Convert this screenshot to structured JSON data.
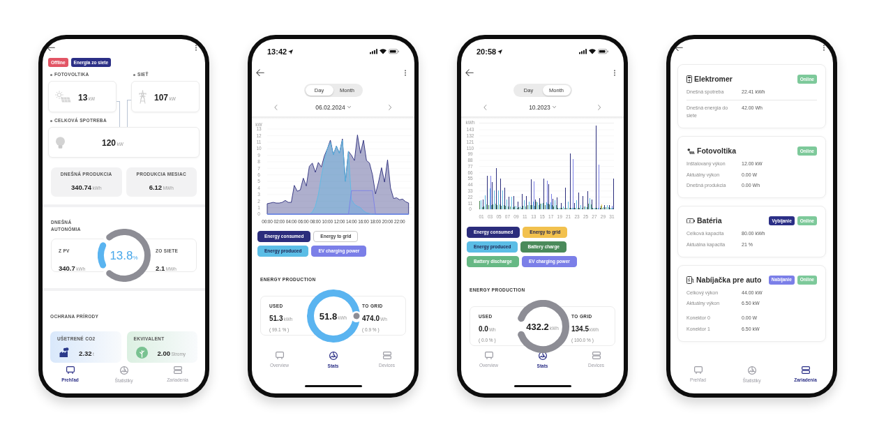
{
  "phones": [
    {
      "kind": "overview",
      "badges": [
        {
          "label": "Offline",
          "color": "#e25565"
        },
        {
          "label": "Energia zo siete",
          "color": "#2b2f86"
        }
      ],
      "flow": {
        "pv": {
          "label": "FOTOVOLTIKA",
          "value": "13",
          "unit": "kW"
        },
        "grid": {
          "label": "SIEŤ",
          "value": "107",
          "unit": "kW"
        },
        "consumption": {
          "label": "CELKOVÁ SPOTREBA",
          "value": "120",
          "unit": "kW"
        }
      },
      "tiles": [
        {
          "label": "DNEŠNÁ PRODUKCIA",
          "value": "340.74",
          "unit": "kWh"
        },
        {
          "label": "PRODUKCIA MESIAC",
          "value": "6.12",
          "unit": "MWh"
        }
      ],
      "autonomy": {
        "title": "DNEŠNÁ AUTONÓMIA",
        "value": "13.8",
        "unit": "%",
        "level": 0.138,
        "left": {
          "label": "Z PV",
          "value": "340.7",
          "unit": "kWh"
        },
        "right": {
          "label": "ZO SIETE",
          "value": "2.1",
          "unit": "MWh"
        }
      },
      "nature": {
        "title": "OCHRANA PRÍRODY",
        "cards": [
          {
            "label": "UŠETRENÉ CO2",
            "value": "2.32",
            "unit": "t",
            "color": "#d9e8fb"
          },
          {
            "label": "EKVIVALENT",
            "value": "2.00",
            "unit": "Stromy",
            "color": "#dcf0e2"
          }
        ]
      },
      "nav": [
        {
          "label": "Prehľad",
          "selected": true
        },
        {
          "label": "Štatistiky",
          "selected": false
        },
        {
          "label": "Zariadenia",
          "selected": false
        }
      ]
    },
    {
      "kind": "stats",
      "status_bar": {
        "time": "13:42"
      },
      "periods": [
        {
          "label": "Day",
          "selected": true
        },
        {
          "label": "Month",
          "selected": false
        }
      ],
      "date": "06.02.2024",
      "chart_data": {
        "type": "area",
        "ylabel": "kW",
        "grid": true,
        "x": [
          0,
          0.5,
          1,
          1.5,
          2,
          2.5,
          3,
          3.5,
          4,
          4.5,
          5,
          5.5,
          6,
          6.5,
          7,
          7.5,
          8,
          8.5,
          9,
          9.5,
          10,
          10.5,
          11,
          11.5,
          12,
          12.5,
          13,
          13.5,
          14,
          14.5,
          15,
          15.5,
          16,
          16.5,
          17,
          17.5,
          18,
          18.5,
          19,
          19.5,
          20,
          20.5,
          21,
          21.5,
          22,
          22.5,
          23,
          23.5
        ],
        "xlim": [
          0,
          24
        ],
        "ylim": [
          0,
          13
        ],
        "xticks": [
          {
            "value": 0,
            "label": "00:00"
          },
          {
            "value": 2,
            "label": "02:00"
          },
          {
            "value": 4,
            "label": "04:00"
          },
          {
            "value": 6,
            "label": "06:00"
          },
          {
            "value": 8,
            "label": "08:00"
          },
          {
            "value": 10,
            "label": "10:00"
          },
          {
            "value": 12,
            "label": "12:00"
          },
          {
            "value": 14,
            "label": "14:00"
          },
          {
            "value": 16,
            "label": "16:00"
          },
          {
            "value": 18,
            "label": "18:00"
          },
          {
            "value": 20,
            "label": "20:00"
          },
          {
            "value": 22,
            "label": "22:00"
          }
        ],
        "yticks": [
          0,
          1,
          2,
          3,
          4,
          5,
          6,
          7,
          8,
          9,
          10,
          11,
          12,
          13
        ],
        "series": [
          {
            "name": "Energy consumed",
            "color": "#2b2d7c",
            "values": [
              1.6,
              1.7,
              1.8,
              1.7,
              1.7,
              1.8,
              2.1,
              1.8,
              1.8,
              4.4,
              3.5,
              3.7,
              5.5,
              4.3,
              7.3,
              7.8,
              6.4,
              7.9,
              7.2,
              8.9,
              10,
              11.3,
              9.1,
              10.4,
              9.3,
              11.5,
              5,
              9.6,
              9,
              8.2,
              12.1,
              9.3,
              11.3,
              8.2,
              7.8,
              6,
              3.1,
              4.9,
              7.1,
              4.9,
              8.3,
              4,
              2.4,
              2.5,
              2.2,
              2.3,
              1.9,
              1.7
            ]
          },
          {
            "name": "Energy to grid",
            "values": [
              null,
              null,
              null,
              null,
              null,
              null,
              null,
              null,
              null,
              null,
              null,
              null,
              null,
              null,
              null,
              null,
              null,
              null,
              null,
              null,
              null,
              null,
              null,
              null,
              null,
              null,
              null,
              null,
              null,
              null,
              null,
              null,
              null,
              null,
              null,
              null,
              null,
              null,
              null,
              null,
              null,
              null,
              null,
              null,
              null,
              null,
              null,
              null
            ]
          },
          {
            "name": "Energy produced",
            "color": "#5bbde6",
            "values": [
              0,
              0,
              0,
              0,
              0,
              0,
              0,
              0,
              0,
              0,
              0,
              0,
              0,
              0,
              0,
              0.3,
              1.2,
              3,
              5.8,
              8.2,
              10,
              11,
              9.1,
              10.4,
              9.3,
              11.3,
              5,
              9.6,
              2.2,
              1.5,
              1.2,
              1,
              0.5,
              0.2,
              0.1,
              0,
              0,
              0,
              0,
              0,
              0,
              0,
              0,
              0,
              0,
              0,
              0,
              0
            ]
          },
          {
            "name": "EV charging power",
            "color": "#7b7fe8",
            "values": [
              0,
              0,
              0,
              0,
              0,
              0,
              0,
              0,
              0,
              0,
              0,
              0,
              0,
              0,
              0,
              0,
              0,
              0,
              0,
              0,
              0,
              0,
              0,
              0,
              0,
              0,
              0,
              0,
              3.6,
              3.6,
              3.6,
              3.6,
              3.6,
              3.6,
              3.6,
              3.6,
              0,
              0,
              0,
              0,
              0,
              0,
              0,
              0,
              0,
              0,
              0,
              0
            ]
          }
        ]
      },
      "legend": [
        {
          "on": true
        },
        {
          "on": false
        },
        {
          "on": true
        },
        {
          "on": true
        }
      ],
      "production": {
        "title": "ENERGY PRODUCTION",
        "used": {
          "label": "USED",
          "value": "51.3",
          "unit": "kWh",
          "share": "( 99.1 % )"
        },
        "total": {
          "value": "51.8",
          "unit": "kWh"
        },
        "level": 0.991,
        "to_grid": {
          "label": "TO GRID",
          "value": "474.0",
          "unit": "Wh",
          "share": "( 0.9 % )"
        }
      },
      "nav": [
        {
          "label": "Overview",
          "selected": false
        },
        {
          "label": "Stats",
          "selected": true
        },
        {
          "label": "Devices",
          "selected": false
        }
      ]
    },
    {
      "kind": "stats",
      "status_bar": {
        "time": "20:58"
      },
      "periods": [
        {
          "label": "Day",
          "selected": false
        },
        {
          "label": "Month",
          "selected": true
        }
      ],
      "date": "10.2023",
      "chart_data": {
        "type": "bar",
        "ylabel": "kWh",
        "grid": true,
        "stacked": false,
        "x": [
          1,
          2,
          3,
          4,
          5,
          6,
          7,
          8,
          9,
          10,
          11,
          12,
          13,
          14,
          15,
          16,
          17,
          18,
          19,
          20,
          21,
          22,
          23,
          24,
          25,
          26,
          27,
          28,
          29,
          30,
          31
        ],
        "xlim": [
          0.5,
          31.5
        ],
        "ylim": [
          0,
          155
        ],
        "xticks": [
          {
            "value": 1,
            "label": "01"
          },
          {
            "value": 3,
            "label": "03"
          },
          {
            "value": 5,
            "label": "05"
          },
          {
            "value": 7,
            "label": "07"
          },
          {
            "value": 9,
            "label": "09"
          },
          {
            "value": 11,
            "label": "11"
          },
          {
            "value": 13,
            "label": "13"
          },
          {
            "value": 15,
            "label": "15"
          },
          {
            "value": 17,
            "label": "17"
          },
          {
            "value": 19,
            "label": "19"
          },
          {
            "value": 21,
            "label": "21"
          },
          {
            "value": 23,
            "label": "23"
          },
          {
            "value": 25,
            "label": "25"
          },
          {
            "value": 27,
            "label": "27"
          },
          {
            "value": 29,
            "label": "29"
          },
          {
            "value": 31,
            "label": "31"
          }
        ],
        "yticks": [
          0,
          11,
          22,
          33,
          44,
          55,
          66,
          77,
          88,
          99,
          110,
          121,
          132,
          143
        ],
        "series": [
          {
            "name": "Energy consumed",
            "color": "#2b2d7c",
            "values": [
              17,
              60,
              49,
              74,
              55,
              39,
              23,
              24,
              14,
              28,
              24,
              54,
              17,
              20,
              55,
              45,
              19,
              21,
              11,
              39,
              100,
              11,
              30,
              24,
              33,
              17,
              151,
              3,
              8,
              8,
              55
            ]
          },
          {
            "name": "Energy to grid",
            "color": "#f2c14e",
            "values": [
              0,
              0,
              0,
              0,
              0,
              0,
              0,
              0,
              0,
              0,
              0,
              0,
              0,
              0,
              0,
              0,
              0,
              0,
              0,
              0,
              0,
              0,
              0,
              0,
              0,
              0,
              0,
              0,
              9,
              0,
              0
            ]
          },
          {
            "name": "Energy produced",
            "color": "#5bbde6",
            "values": [
              16,
              25,
              38,
              34,
              34,
              34,
              18,
              23,
              6,
              5,
              16,
              14,
              14,
              12,
              10,
              13,
              12,
              16,
              3,
              5,
              14,
              3,
              16,
              8,
              5,
              20,
              2,
              2,
              3,
              8,
              3
            ]
          },
          {
            "name": "Battery charge",
            "color": "#4a8a5a",
            "values": [
              15,
              5,
              8,
              9,
              8,
              6,
              6,
              5,
              5,
              4,
              6,
              7,
              7,
              14,
              10,
              8,
              9,
              5,
              3,
              3,
              2,
              2,
              3,
              3,
              5,
              10,
              2,
              3,
              6,
              4,
              2
            ]
          },
          {
            "name": "Battery discharge",
            "color": "#66b884",
            "values": [
              4,
              9,
              8,
              10,
              9,
              7,
              5,
              4,
              3,
              3,
              5,
              7,
              6,
              8,
              11,
              10,
              8,
              7,
              3,
              3,
              3,
              2,
              3,
              3,
              4,
              9,
              2,
              0,
              4,
              4,
              3
            ]
          },
          {
            "name": "EV charging power",
            "color": "#7b7fe8",
            "values": [
              0,
              0,
              60,
              0,
              0,
              0,
              0,
              0,
              0,
              0,
              0,
              0,
              50,
              0,
              0,
              51,
              27,
              0,
              0,
              0,
              0,
              90,
              0,
              0,
              0,
              0,
              0,
              80,
              0,
              0,
              6
            ]
          }
        ]
      },
      "legend": [
        {
          "on": true
        },
        {
          "on": true
        },
        {
          "on": true
        },
        {
          "on": true
        },
        {
          "on": true
        },
        {
          "on": true
        }
      ],
      "production": {
        "title": "ENERGY PRODUCTION",
        "used": {
          "label": "USED",
          "value": "0.0",
          "unit": "Wh",
          "share": "( 0.0 % )"
        },
        "total": {
          "value": "432.2",
          "unit": "kWh"
        },
        "level": 0,
        "to_grid": {
          "label": "TO GRID",
          "value": "134.5",
          "unit": "kWh",
          "share": "( 100.0 % )"
        }
      },
      "nav": [
        {
          "label": "Overview",
          "selected": false
        },
        {
          "label": "Stats",
          "selected": true
        },
        {
          "label": "Devices",
          "selected": false
        }
      ]
    },
    {
      "kind": "devices",
      "devices": [
        {
          "name": "Elektromer",
          "badges": [
            {
              "label": "Online",
              "color": "#7dc99a"
            }
          ],
          "divided": true,
          "sections": [
            [
              {
                "label": "Dnešná spotreba",
                "value": "22.41 kWh"
              }
            ],
            [
              {
                "label": "Dnešná energia do siete",
                "value": "42.00 Wh"
              }
            ]
          ]
        },
        {
          "name": "Fotovoltika",
          "badges": [
            {
              "label": "Online",
              "color": "#7dc99a"
            }
          ],
          "sections": [
            [
              {
                "label": "Inštalovaný výkon",
                "value": "12.00 kW"
              },
              {
                "label": "Aktuálny výkon",
                "value": "0.00 W"
              },
              {
                "label": "Dnešná produkcia",
                "value": "0.00 Wh"
              }
            ]
          ]
        },
        {
          "name": "Batéria",
          "badges": [
            {
              "label": "Vybíjanie",
              "color": "#2b2f86"
            },
            {
              "label": "Online",
              "color": "#7dc99a"
            }
          ],
          "sections": [
            [
              {
                "label": "Celková kapacita",
                "value": "80.00 kWh"
              },
              {
                "label": "Aktuálna kapacita",
                "value": "21 %"
              }
            ]
          ]
        },
        {
          "name": "Nabíjačka pre auto",
          "badges": [
            {
              "label": "Nabíjanie",
              "color": "#7b7fe8"
            },
            {
              "label": "Online",
              "color": "#7dc99a"
            }
          ],
          "divided": false,
          "sections": [
            [
              {
                "label": "Celkový výkon",
                "value": "44.00 kW"
              },
              {
                "label": "Aktuálny výkon",
                "value": "6.50 kW"
              }
            ],
            [
              {
                "label": "Konektor 0",
                "value": "0.00 W"
              },
              {
                "label": "Konektor 1",
                "value": "6.50 kW"
              }
            ]
          ]
        }
      ],
      "nav": [
        {
          "label": "Prehľad",
          "selected": false
        },
        {
          "label": "Štatistiky",
          "selected": false
        },
        {
          "label": "Zariadenia",
          "selected": true
        }
      ]
    }
  ]
}
